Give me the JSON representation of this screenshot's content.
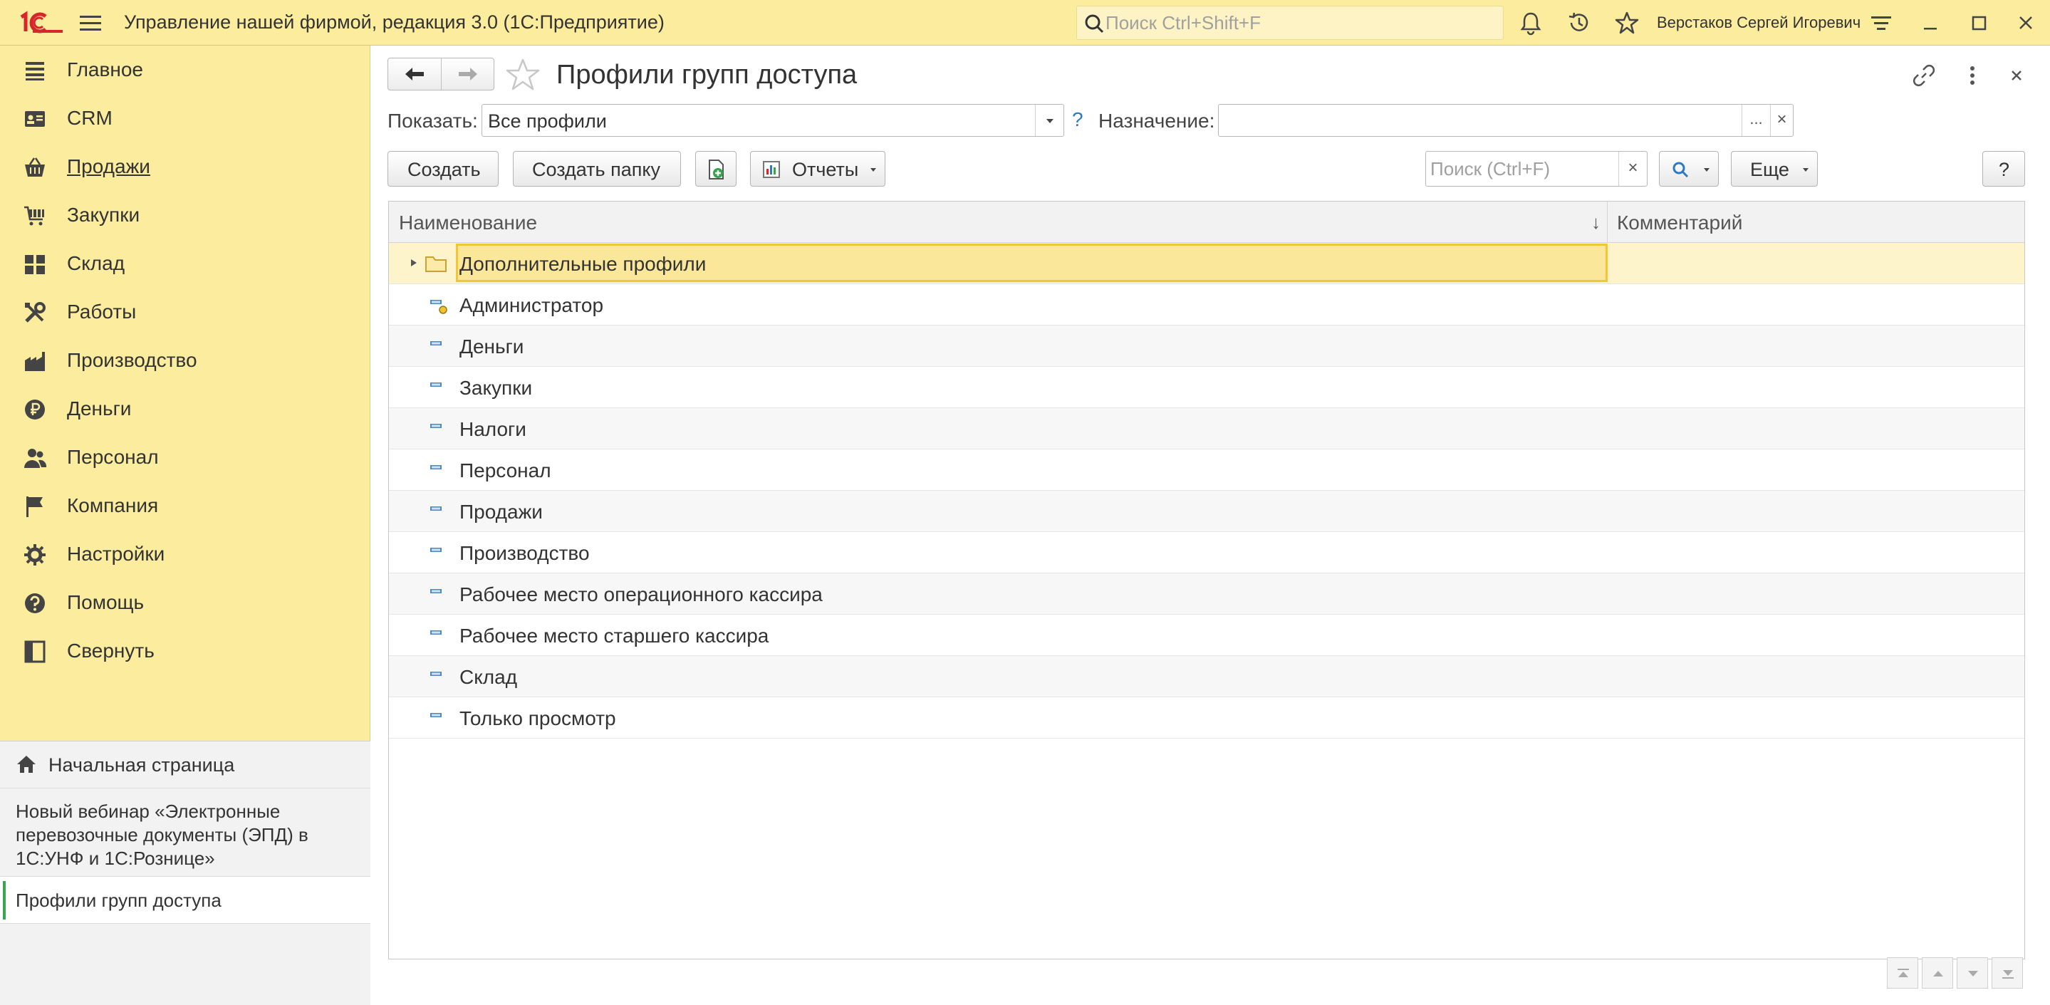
{
  "titlebar": {
    "logo_text": "1С",
    "title": "Управление нашей фирмой, редакция 3.0  (1С:Предприятие)",
    "search_placeholder": "Поиск Ctrl+Shift+F",
    "user": "Верстаков Сергей Игоревич",
    "icons": [
      "bell-icon",
      "history-icon",
      "star-icon",
      "settings-icon",
      "minimize-icon",
      "maximize-icon",
      "close-icon"
    ]
  },
  "sidebar": {
    "items": [
      {
        "label": "Главное",
        "icon": "menu-lines-icon"
      },
      {
        "label": "CRM",
        "icon": "contact-card-icon"
      },
      {
        "label": "Продажи",
        "icon": "basket-icon"
      },
      {
        "label": "Закупки",
        "icon": "cart-icon"
      },
      {
        "label": "Склад",
        "icon": "grid-blocks-icon"
      },
      {
        "label": "Работы",
        "icon": "tools-icon"
      },
      {
        "label": "Производство",
        "icon": "factory-icon"
      },
      {
        "label": "Деньги",
        "icon": "ruble-icon"
      },
      {
        "label": "Персонал",
        "icon": "people-icon"
      },
      {
        "label": "Компания",
        "icon": "flag-icon"
      },
      {
        "label": "Настройки",
        "icon": "gear-icon"
      },
      {
        "label": "Помощь",
        "icon": "help-icon"
      },
      {
        "label": "Свернуть",
        "icon": "collapse-panel-icon"
      }
    ],
    "open_windows": {
      "home": "Начальная страница",
      "webinar": "Новый вебинар «Электронные перевозочные документы (ЭПД) в 1С:УНФ и 1С:Рознице»",
      "current": "Профили групп доступа"
    }
  },
  "form": {
    "title": "Профили групп доступа",
    "show_label": "Показать:",
    "show_value": "Все профили",
    "help_mark": "?",
    "dest_label": "Назначение:",
    "dest_value": "",
    "dest_dots": "...",
    "clear_glyph": "×"
  },
  "toolbar": {
    "create": "Создать",
    "create_folder": "Создать папку",
    "reports": "Отчеты",
    "search_placeholder": "Поиск (Ctrl+F)",
    "more": "Еще",
    "help": "?"
  },
  "table": {
    "columns": [
      "Наименование",
      "Комментарий"
    ],
    "sort_glyph": "↓",
    "rows": [
      {
        "name": "Дополнительные профили",
        "type": "folder",
        "comment": ""
      },
      {
        "name": "Администратор",
        "type": "admin",
        "comment": ""
      },
      {
        "name": "Деньги",
        "type": "item",
        "comment": ""
      },
      {
        "name": "Закупки",
        "type": "item",
        "comment": ""
      },
      {
        "name": "Налоги",
        "type": "item",
        "comment": ""
      },
      {
        "name": "Персонал",
        "type": "item",
        "comment": ""
      },
      {
        "name": "Продажи",
        "type": "item",
        "comment": ""
      },
      {
        "name": "Производство",
        "type": "item",
        "comment": ""
      },
      {
        "name": "Рабочее место операционного кассира",
        "type": "item",
        "comment": ""
      },
      {
        "name": "Рабочее место старшего кассира",
        "type": "item",
        "comment": ""
      },
      {
        "name": "Склад",
        "type": "item",
        "comment": ""
      },
      {
        "name": "Только просмотр",
        "type": "item",
        "comment": ""
      }
    ]
  },
  "colors": {
    "panel_yellow": "#fbec9e",
    "selection_fill": "#fbe79a",
    "selection_border": "#f2c53a",
    "logo_red": "#d6262b",
    "link_blue": "#2a7ac5",
    "active_marker": "#3ca64f"
  }
}
